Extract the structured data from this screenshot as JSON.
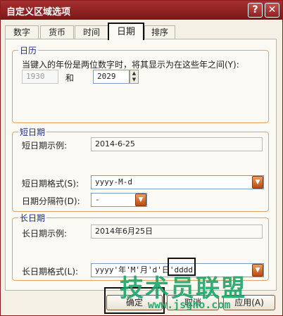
{
  "window": {
    "title": "自定义区域选项"
  },
  "titlebar_buttons": {
    "help": "?",
    "close": "✕"
  },
  "tabs": [
    {
      "label": "数字"
    },
    {
      "label": "货币"
    },
    {
      "label": "时间"
    },
    {
      "label": "日期"
    },
    {
      "label": "排序"
    }
  ],
  "calendar": {
    "group_label": "日历",
    "description": "当键入的年份是两位数字时，将其显示为在这些年之间(Y):",
    "from_value": "1930",
    "and_label": "和",
    "to_value": "2029"
  },
  "short_date": {
    "group_label": "短日期",
    "sample_label": "短日期示例:",
    "sample_value": "2014-6-25",
    "format_label": "短日期格式(S):",
    "format_value": "yyyy-M-d",
    "separator_label": "日期分隔符(D):",
    "separator_value": "-"
  },
  "long_date": {
    "group_label": "长日期",
    "sample_label": "长日期示例:",
    "sample_value": "2014年6月25日",
    "format_label": "长日期格式(L):",
    "format_value": "yyyy'年'M'月'd'日'dddd"
  },
  "buttons": {
    "ok": "确定",
    "cancel": "取消",
    "apply": "应用(A)"
  },
  "watermark": {
    "text_zh": "技术员联盟",
    "text_en": "www.jsgho.com"
  }
}
